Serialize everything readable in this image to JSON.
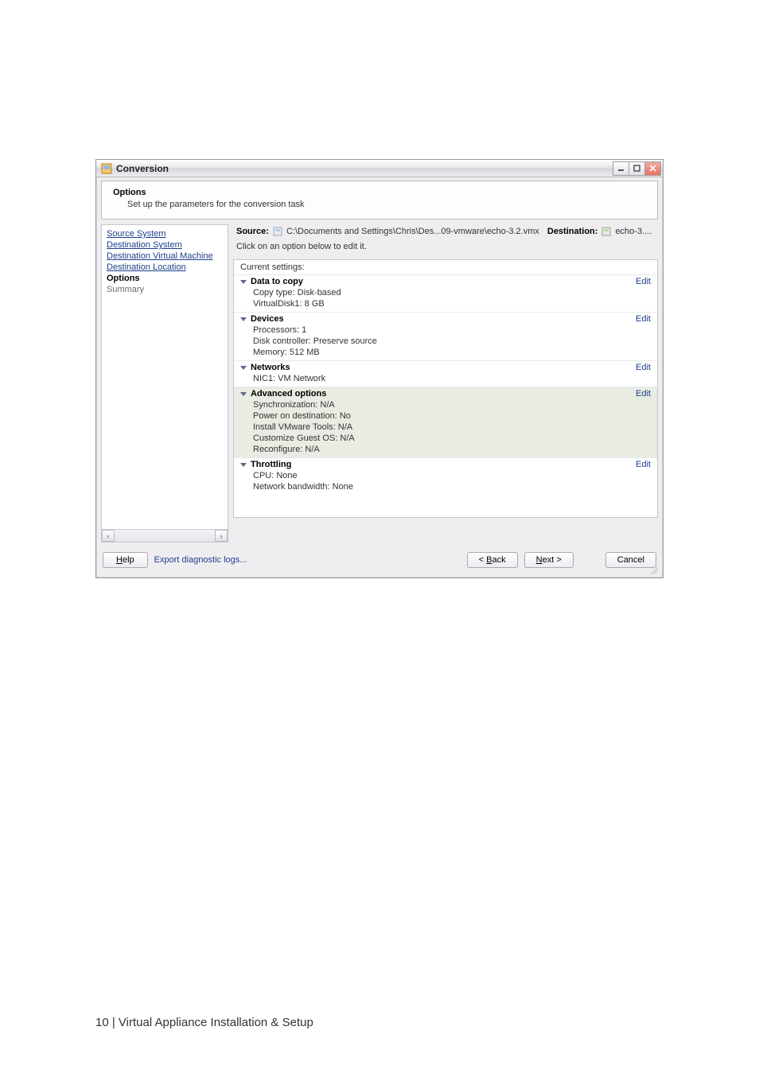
{
  "window": {
    "title": "Conversion"
  },
  "header": {
    "title": "Options",
    "sub": "Set up the parameters for the conversion task"
  },
  "nav": {
    "items": [
      {
        "label": "Source System",
        "link": true
      },
      {
        "label": "Destination System",
        "link": true
      },
      {
        "label": "Destination Virtual Machine",
        "link": true
      },
      {
        "label": "Destination Location",
        "link": true
      },
      {
        "label": "Options",
        "current": true
      },
      {
        "label": "Summary",
        "plain": true
      }
    ]
  },
  "info": {
    "source_label": "Source:",
    "source_path": "C:\\Documents and Settings\\Chris\\Des...09-vmware\\echo-3.2.vmx",
    "dest_label": "Destination:",
    "dest_value": "echo-3....",
    "hint": "Click on an option below to edit it."
  },
  "settings": {
    "current_label": "Current settings:",
    "groups": [
      {
        "id": "data-to-copy",
        "title": "Data to copy",
        "lines": [
          "Copy type: Disk-based",
          "VirtualDisk1: 8 GB"
        ],
        "edit": "Edit",
        "selected": false
      },
      {
        "id": "devices",
        "title": "Devices",
        "lines": [
          "Processors: 1",
          "Disk controller: Preserve source",
          "Memory: 512 MB"
        ],
        "edit": "Edit",
        "selected": false
      },
      {
        "id": "networks",
        "title": "Networks",
        "lines": [
          "NIC1: VM Network"
        ],
        "edit": "Edit",
        "selected": false
      },
      {
        "id": "advanced",
        "title": "Advanced options",
        "lines": [
          "Synchronization: N/A",
          "Power on destination: No",
          "Install VMware Tools: N/A",
          "Customize Guest OS: N/A",
          "Reconfigure: N/A"
        ],
        "edit": "Edit",
        "selected": true
      },
      {
        "id": "throttling",
        "title": "Throttling",
        "lines": [
          "CPU: None",
          "Network bandwidth: None"
        ],
        "edit": "Edit",
        "selected": false
      }
    ]
  },
  "footer": {
    "help": "Help",
    "export": "Export diagnostic logs...",
    "back": "< Back",
    "next": "Next >",
    "cancel": "Cancel"
  },
  "pageFooter": "10 | Virtual Appliance Installation & Setup",
  "icons": {
    "app": "app-icon",
    "source": "vm-file-icon",
    "dest": "vm-dest-icon",
    "minimize": "minimize-icon",
    "maximize": "maximize-icon",
    "close": "close-icon",
    "chevron": "chevron-down-icon"
  }
}
